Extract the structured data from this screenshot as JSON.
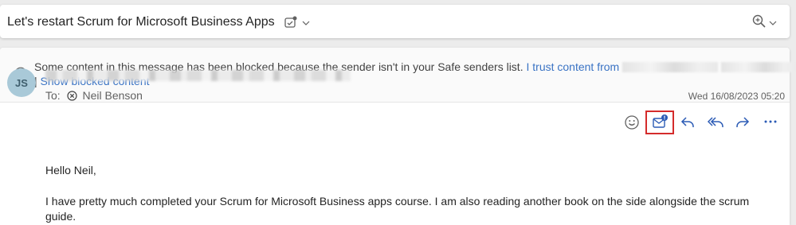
{
  "header": {
    "subject": "Let's restart Scrum for Microsoft Business Apps"
  },
  "banner": {
    "message": "Some content in this message has been blocked because the sender isn't in your Safe senders list.",
    "trust_link": "I trust content from",
    "separator": "|",
    "show_blocked_link": "Show blocked content"
  },
  "message": {
    "avatar_initials": "JS",
    "to_label": "To:",
    "recipient": "Neil Benson",
    "date": "Wed 16/08/2023 05:20",
    "greeting": "Hello Neil,",
    "paragraph_line1": "I have pretty much completed your Scrum for Microsoft Business apps course. I am also reading another book on the side alongside the scrum",
    "paragraph_line2": "guide."
  },
  "colors": {
    "link": "#3a73c4",
    "avatar_bg": "#a9c9d8",
    "highlight_border": "#d42b2b",
    "badge": "#2b5bb5"
  },
  "icons": [
    "tag-icon",
    "chevron-down-icon",
    "zoom-icon",
    "info-icon",
    "emoji-icon",
    "mail-notification-icon",
    "reply-icon",
    "reply-all-icon",
    "forward-icon",
    "more-icon",
    "blocked-user-icon"
  ]
}
